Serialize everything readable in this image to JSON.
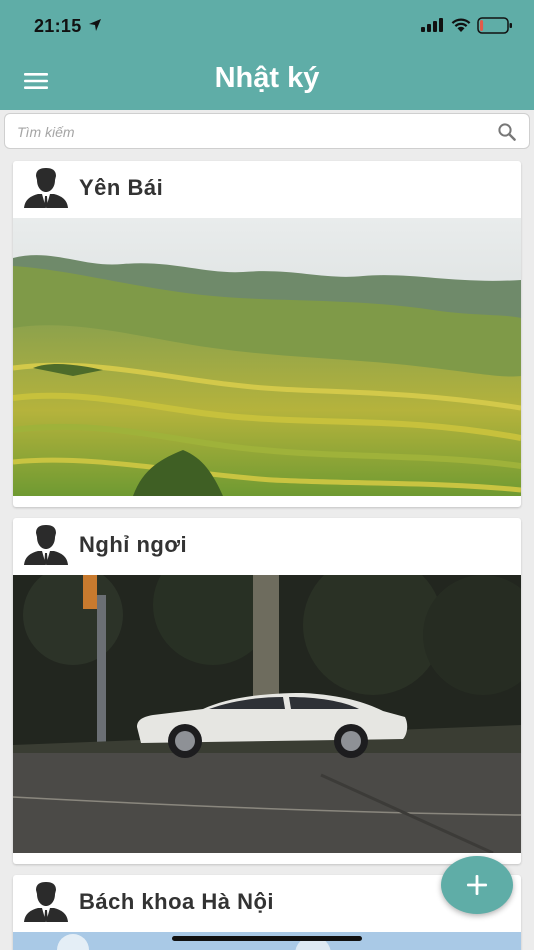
{
  "status_bar": {
    "time": "21:15",
    "location_icon": "location-arrow-icon",
    "signal_icon": "cellular-signal-icon",
    "wifi_icon": "wifi-icon",
    "battery_icon": "battery-low-icon",
    "battery_level": 0.12,
    "battery_color": "#e25a4a"
  },
  "app_bar": {
    "title": "Nhật ký",
    "menu_icon": "hamburger-menu-icon",
    "background_color": "#5fada7"
  },
  "search": {
    "placeholder": "Tìm kiếm",
    "value": "",
    "icon": "search-icon"
  },
  "entries": [
    {
      "title": "Yên Bái",
      "avatar_icon": "user-avatar-icon",
      "photo": "terraced rice fields in mountains"
    },
    {
      "title": "Nghỉ ngơi",
      "avatar_icon": "user-avatar-icon",
      "photo": "white sedan parked by roadside at night"
    },
    {
      "title": "Bách khoa Hà Nội",
      "avatar_icon": "user-avatar-icon",
      "photo": "sky"
    }
  ],
  "fab": {
    "icon": "plus-icon",
    "color": "#5fada7"
  }
}
